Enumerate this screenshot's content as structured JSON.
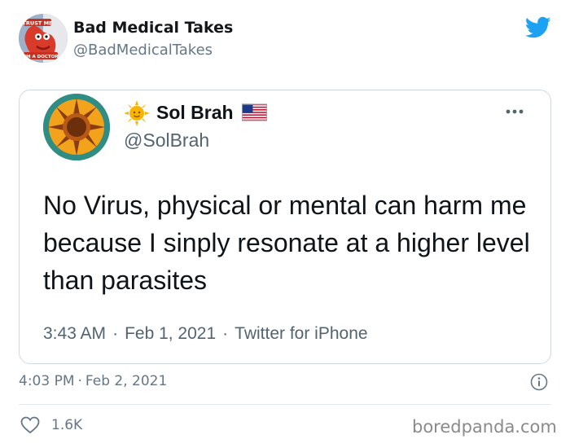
{
  "outer_tweet": {
    "author_name": "Bad Medical Takes",
    "author_handle": "@BadMedicalTakes",
    "avatar_caption_top": "TRUST ME",
    "avatar_caption_bottom": "I'M A DOCTOR",
    "time": "4:03 PM",
    "separator": "·",
    "date": "Feb 2, 2021",
    "likes": "1.6K"
  },
  "quoted_tweet": {
    "author_name": "Sol Brah",
    "author_handle": "@SolBrah",
    "text": "No Virus, physical or mental can harm me because I sinply resonate at a higher level than parasites",
    "time": "3:43 AM",
    "separator": "·",
    "date": "Feb 1, 2021",
    "source": "Twitter for iPhone"
  },
  "watermark": "boredpanda.com",
  "icons": {
    "platform": "twitter-bird-icon",
    "more": "more-options-icon",
    "info": "info-icon",
    "like": "heart-icon",
    "name_prefix": "sun-emoji-icon",
    "name_suffix": "us-flag-icon"
  },
  "colors": {
    "twitter_blue": "#1da1f2",
    "name_text": "#14171a",
    "secondary_text": "#657786",
    "card_border": "#cfd9de"
  }
}
